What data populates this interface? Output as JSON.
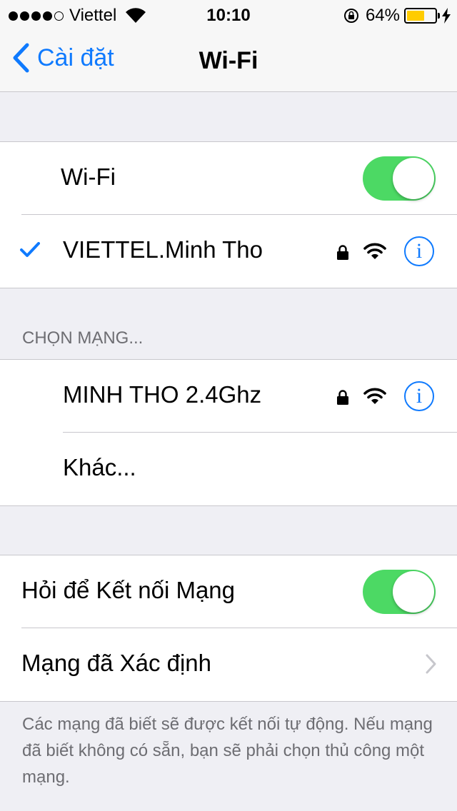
{
  "status_bar": {
    "carrier": "Viettel",
    "time": "10:10",
    "battery_percent": "64%",
    "battery_level": 0.64,
    "signal_bars": 4,
    "colors": {
      "battery_fill": "#ffcc00"
    }
  },
  "nav": {
    "back_label": "Cài đặt",
    "title": "Wi-Fi",
    "accent_color": "#0f7afe"
  },
  "wifi_section": {
    "toggle_label": "Wi-Fi",
    "toggle_on": true,
    "connected_network": "VIETTEL.Minh Tho"
  },
  "choose_network": {
    "header": "CHỌN MẠNG...",
    "networks": [
      {
        "name": "MINH THO 2.4Ghz",
        "secured": true
      }
    ],
    "other_label": "Khác..."
  },
  "settings": {
    "ask_join_label": "Hỏi để Kết nối Mạng",
    "ask_join_on": true,
    "known_networks_label": "Mạng đã Xác định"
  },
  "footer_text": "Các mạng đã biết sẽ được kết nối tự động. Nếu mạng đã biết không có sẵn, bạn sẽ phải chọn thủ công một mạng.",
  "icons": [
    "wifi-signal-icon",
    "orientation-lock-icon",
    "charging-bolt-icon",
    "back-chevron-icon",
    "checkmark-icon",
    "lock-icon",
    "wifi-icon",
    "info-icon",
    "chevron-right-icon"
  ],
  "toggle_color": "#4cd964"
}
